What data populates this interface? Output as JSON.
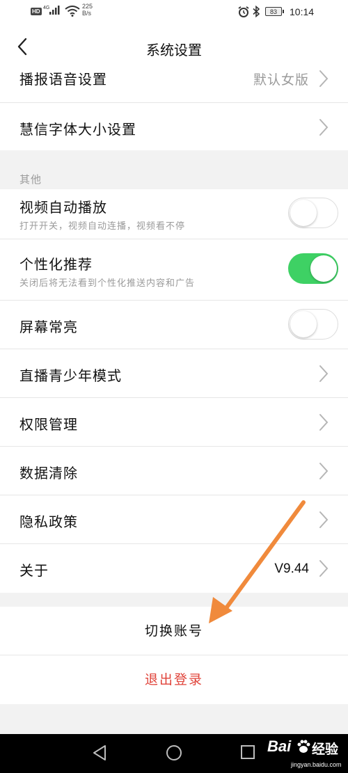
{
  "status_bar": {
    "hd_badge": "HD",
    "network": "4G",
    "speed_value": "225",
    "speed_unit": "B/s",
    "battery": "83",
    "time": "10:14"
  },
  "header": {
    "title": "系统设置"
  },
  "settings_top": [
    {
      "label": "播报语音设置",
      "value": "默认女版"
    },
    {
      "label": "慧信字体大小设置"
    }
  ],
  "other_section": {
    "title": "其他",
    "toggles": [
      {
        "label": "视频自动播放",
        "subtitle": "打开开关，视频自动连播，视频看不停",
        "state": "off"
      },
      {
        "label": "个性化推荐",
        "subtitle": "关闭后将无法看到个性化推送内容和广告",
        "state": "on"
      },
      {
        "label": "屏幕常亮",
        "state": "off"
      }
    ],
    "links": [
      {
        "label": "直播青少年模式"
      },
      {
        "label": "权限管理"
      },
      {
        "label": "数据清除"
      },
      {
        "label": "隐私政策"
      },
      {
        "label": "关于",
        "value": "V9.44"
      }
    ]
  },
  "actions": {
    "switch_account": "切换账号",
    "logout": "退出登录"
  },
  "watermark": {
    "brand": "Bai",
    "brand_cn": "经验",
    "url": "jingyan.baidu.com"
  },
  "colors": {
    "toggle_on": "#3ed164",
    "logout_text": "#e0433a",
    "annotation_arrow": "#f08a3c",
    "section_bg": "#f2f2f2"
  }
}
